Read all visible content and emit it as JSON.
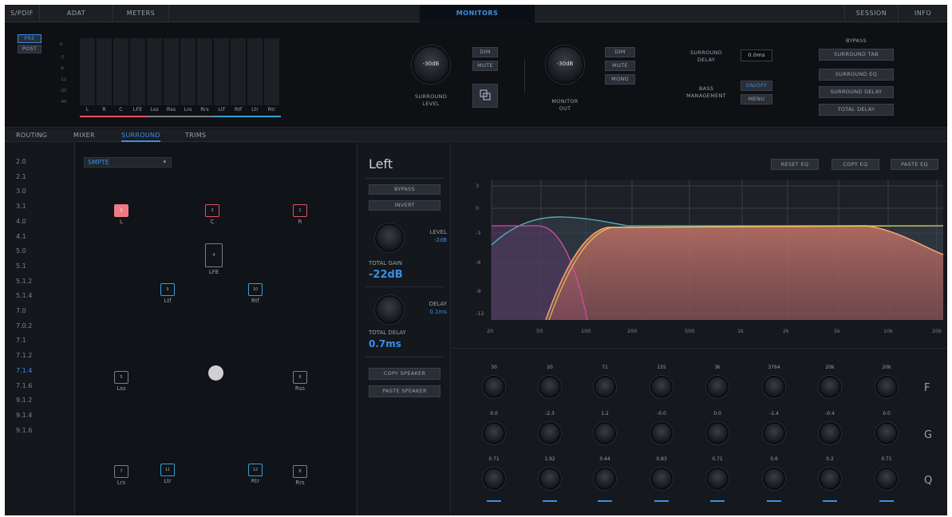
{
  "top_nav": {
    "left_tabs": [
      "S/PDIF",
      "ADAT",
      "METERS"
    ],
    "center_tab": "MONITORS",
    "right_tabs": [
      "SESSION",
      "INFO"
    ]
  },
  "meters": {
    "pre_label": "PRE",
    "post_label": "POST",
    "scale": [
      "0",
      "-3",
      "-6",
      "-12",
      "-20",
      "-40"
    ],
    "channels": [
      {
        "label": "L",
        "color": "#e05363"
      },
      {
        "label": "R",
        "color": "#e05363"
      },
      {
        "label": "C",
        "color": "#e05363"
      },
      {
        "label": "LFE",
        "color": "#e05363"
      },
      {
        "label": "Lss",
        "color": "#7a7f86"
      },
      {
        "label": "Rss",
        "color": "#7a7f86"
      },
      {
        "label": "Lrs",
        "color": "#7a7f86"
      },
      {
        "label": "Rrs",
        "color": "#7a7f86"
      },
      {
        "label": "Ltf",
        "color": "#3b9fd6"
      },
      {
        "label": "Rtf",
        "color": "#3b9fd6"
      },
      {
        "label": "Ltr",
        "color": "#3b9fd6"
      },
      {
        "label": "Rtr",
        "color": "#3b9fd6"
      }
    ]
  },
  "surround_level": {
    "knob_value": "-30dB",
    "label_line1": "SURROUND",
    "label_line2": "LEVEL",
    "dim_label": "DIM",
    "mute_label": "MUTE",
    "link_icon": "link-window-icon"
  },
  "monitor_out": {
    "knob_value": "-30dB",
    "label_line1": "MONITOR",
    "label_line2": "OUT",
    "dim_label": "DIM",
    "mute_label": "MUTE",
    "mono_label": "MONO"
  },
  "surround_delay": {
    "label_line1": "SURROUND",
    "label_line2": "DELAY",
    "value": "0.0ms"
  },
  "bass_management": {
    "label_line1": "BASS",
    "label_line2": "MANAGEMENT",
    "onoff_label": "ON/OFF",
    "menu_label": "MENU"
  },
  "bypass": {
    "title": "BYPASS",
    "buttons": [
      "SURROUND TAB",
      "SURROUND EQ",
      "SURROUND DELAY",
      "TOTAL DELAY"
    ]
  },
  "sub_tabs": [
    "ROUTING",
    "MIXER",
    "SURROUND",
    "TRIMS"
  ],
  "formats": {
    "items": [
      "2.0",
      "2.1",
      "3.0",
      "3.1",
      "4.0",
      "4.1",
      "5.0",
      "5.1",
      "5.1.2",
      "5.1.4",
      "7.0",
      "7.0.2",
      "7.1",
      "7.1.2",
      "7.1.4",
      "7.1.6",
      "9.1.2",
      "9.1.4",
      "9.1.6"
    ],
    "selected": "7.1.4"
  },
  "layout_select": {
    "value": "SMPTE"
  },
  "speakers": [
    {
      "num": "1",
      "label": "L",
      "style": "sel"
    },
    {
      "num": "3",
      "label": "C",
      "style": "red"
    },
    {
      "num": "2",
      "label": "R",
      "style": "red"
    },
    {
      "num": "4",
      "label": "LFE",
      "style": "plain"
    },
    {
      "num": "9",
      "label": "Ltf",
      "style": "blue"
    },
    {
      "num": "10",
      "label": "Rtf",
      "style": "blue"
    },
    {
      "num": "5",
      "label": "Lss",
      "style": "plain"
    },
    {
      "num": "6",
      "label": "Rss",
      "style": "plain"
    },
    {
      "num": "7",
      "label": "Lrs",
      "style": "plain"
    },
    {
      "num": "11",
      "label": "Ltr",
      "style": "blue"
    },
    {
      "num": "12",
      "label": "Rtr",
      "style": "blue"
    },
    {
      "num": "8",
      "label": "Rrs",
      "style": "plain"
    }
  ],
  "channel_panel": {
    "title": "Left",
    "bypass_label": "BYPASS",
    "invert_label": "INVERT",
    "level_label": "LEVEL",
    "level_value": "-2dB",
    "total_gain_label": "TOTAL GAIN",
    "total_gain_value": "-22dB",
    "delay_label": "DELAY",
    "delay_value": "0.1ms",
    "total_delay_label": "TOTAL DELAY",
    "total_delay_value": "0.7ms",
    "copy_speaker_label": "COPY SPEAKER",
    "paste_speaker_label": "PASTE SPEAKER"
  },
  "eq": {
    "reset_label": "RESET EQ",
    "copy_label": "COPY EQ",
    "paste_label": "PASTE EQ",
    "y_ticks": [
      "3",
      "0",
      "-3",
      "-6",
      "-9",
      "-12"
    ],
    "x_ticks": [
      "20",
      "50",
      "100",
      "200",
      "500",
      "1k",
      "2k",
      "5k",
      "10k",
      "20k"
    ],
    "band_freqs": [
      "30",
      "20",
      "71",
      "155",
      "3k",
      "3764",
      "20k",
      "20k"
    ],
    "band_gains": [
      "0.0",
      "-2.3",
      "1.2",
      "-0.0",
      "0.0",
      "-1.4",
      "-0.4",
      "0.0"
    ],
    "band_q": [
      "0.71",
      "1.92",
      "0.44",
      "0.83",
      "0.71",
      "0.6",
      "0.2",
      "0.71"
    ],
    "row_labels": [
      "F",
      "G",
      "Q"
    ]
  }
}
